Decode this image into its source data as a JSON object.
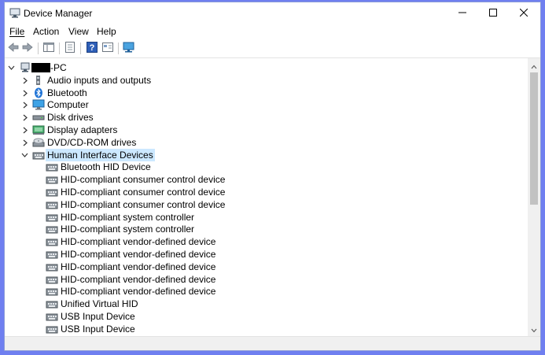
{
  "window": {
    "title": "Device Manager",
    "controls": {
      "minimize_icon": "minimize-icon",
      "maximize_icon": "maximize-icon",
      "close_icon": "close-icon"
    }
  },
  "menu": {
    "items": [
      {
        "label": "File"
      },
      {
        "label": "Action"
      },
      {
        "label": "View"
      },
      {
        "label": "Help"
      }
    ]
  },
  "toolbar": {
    "buttons": [
      "back-arrow-icon",
      "forward-arrow-icon",
      "properties-icon",
      "update-driver-icon",
      "help-icon",
      "console-tree-icon",
      "scan-hardware-icon"
    ]
  },
  "tree": {
    "root": {
      "label": "-PC",
      "redacted": true
    },
    "categories": [
      {
        "label": "Audio inputs and outputs",
        "icon": "speaker-icon",
        "expanded": false
      },
      {
        "label": "Bluetooth",
        "icon": "bluetooth-icon",
        "expanded": false
      },
      {
        "label": "Computer",
        "icon": "computer-icon",
        "expanded": false
      },
      {
        "label": "Disk drives",
        "icon": "disk-drive-icon",
        "expanded": false
      },
      {
        "label": "Display adapters",
        "icon": "display-adapter-icon",
        "expanded": false
      },
      {
        "label": "DVD/CD-ROM drives",
        "icon": "dvd-drive-icon",
        "expanded": false
      },
      {
        "label": "Human Interface Devices",
        "icon": "hid-icon",
        "expanded": true,
        "selected": true
      }
    ],
    "hid_children": [
      {
        "label": "Bluetooth HID Device"
      },
      {
        "label": "HID-compliant consumer control device"
      },
      {
        "label": "HID-compliant consumer control device"
      },
      {
        "label": "HID-compliant consumer control device"
      },
      {
        "label": "HID-compliant system controller"
      },
      {
        "label": "HID-compliant system controller"
      },
      {
        "label": "HID-compliant vendor-defined device"
      },
      {
        "label": "HID-compliant vendor-defined device"
      },
      {
        "label": "HID-compliant vendor-defined device"
      },
      {
        "label": "HID-compliant vendor-defined device"
      },
      {
        "label": "HID-compliant vendor-defined device"
      },
      {
        "label": "Unified Virtual HID"
      },
      {
        "label": "USB Input Device"
      },
      {
        "label": "USB Input Device"
      }
    ]
  },
  "colors": {
    "selection": "#cce8ff",
    "accent": "#1e73d6"
  }
}
